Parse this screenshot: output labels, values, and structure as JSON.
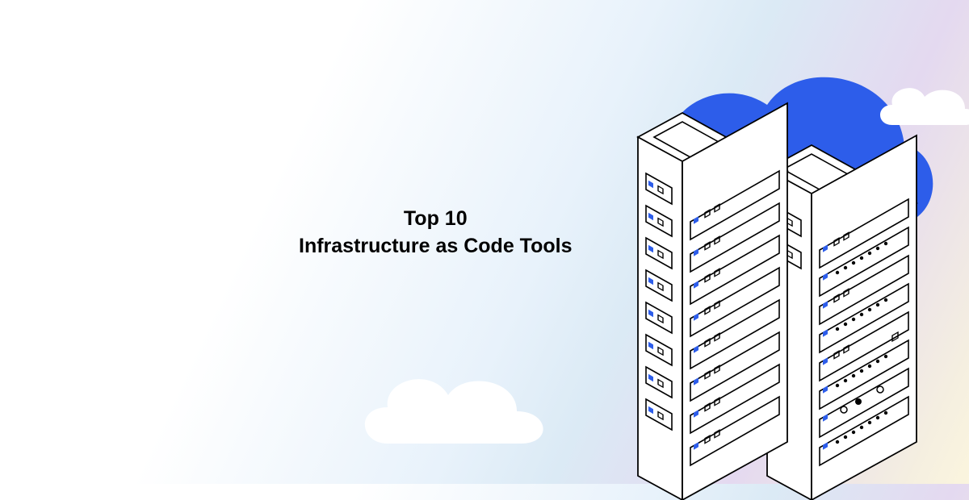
{
  "title": {
    "line1": "Top 10",
    "line2": "Infrastructure as Code Tools"
  },
  "colors": {
    "accent_blue": "#2d5dea",
    "server_indicator": "#2d5dea"
  }
}
